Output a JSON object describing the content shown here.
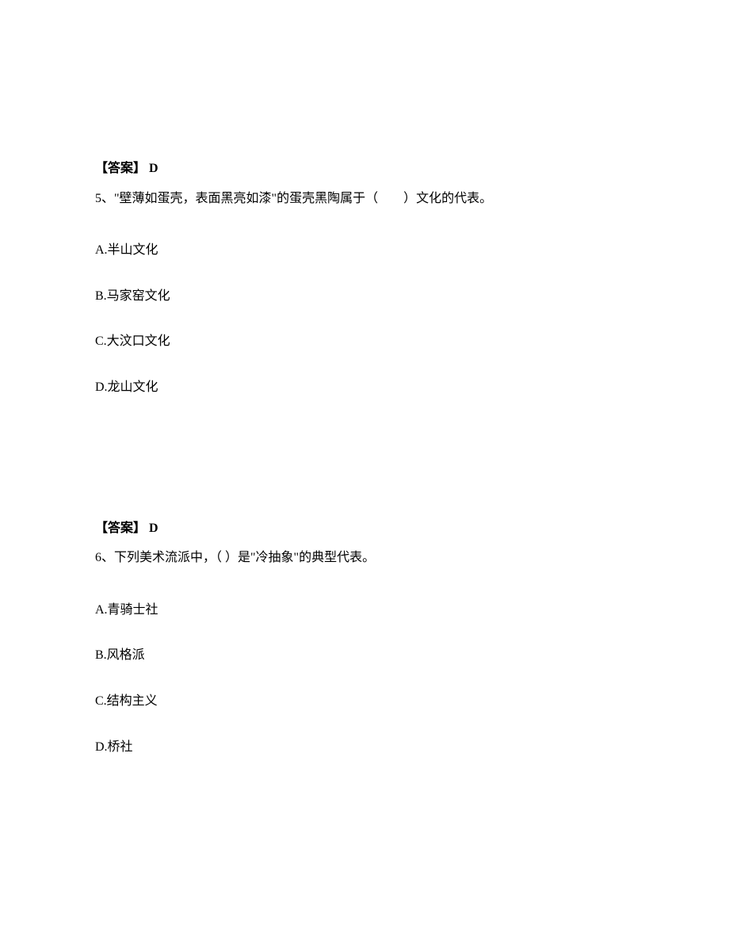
{
  "block1": {
    "answer": "【答案】  D",
    "question": "5、\"壁薄如蛋壳，表面黑亮如漆\"的蛋壳黑陶属于（　　）文化的代表。",
    "optionA": "A.半山文化",
    "optionB": "B.马家窑文化",
    "optionC": "C.大汶口文化",
    "optionD": "D.龙山文化"
  },
  "block2": {
    "answer": "【答案】  D",
    "question": "6、下列美术流派中，（  ）是\"冷抽象\"的典型代表。",
    "optionA": "A.青骑士社",
    "optionB": "B.风格派",
    "optionC": "C.结构主义",
    "optionD": "D.桥社"
  }
}
